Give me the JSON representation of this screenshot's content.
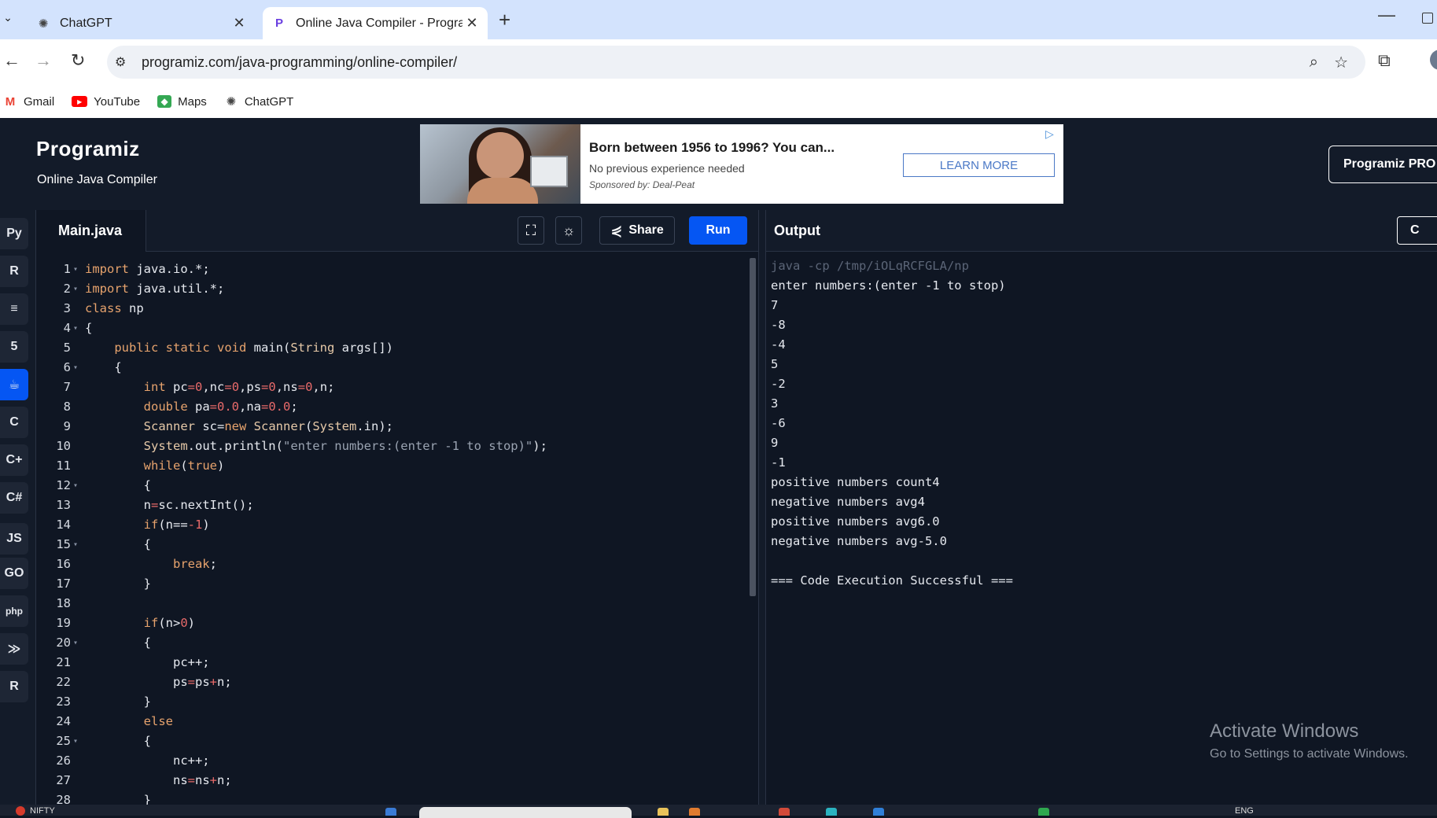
{
  "browser": {
    "tabs": [
      {
        "title": "ChatGPT",
        "icon": "chatgpt-icon",
        "active": false
      },
      {
        "title": "Online Java Compiler - Program",
        "icon": "programiz-icon",
        "active": true
      }
    ],
    "url": "programiz.com/java-programming/online-compiler/",
    "bookmarks": [
      {
        "label": "Gmail",
        "icon": "gmail-icon",
        "color": "#ea4335"
      },
      {
        "label": "YouTube",
        "icon": "youtube-icon",
        "color": "#ff0000"
      },
      {
        "label": "Maps",
        "icon": "maps-icon",
        "color": "#34a853"
      },
      {
        "label": "ChatGPT",
        "icon": "chatgpt-icon",
        "color": "#444444"
      }
    ]
  },
  "header": {
    "logo": "Programiz",
    "subtitle": "Online Java Compiler",
    "pro_button": "Programiz PRO",
    "ad": {
      "title": "Born between 1956 to 1996? You can...",
      "description": "No previous experience needed",
      "sponsor": "Sponsored by: Deal-Peat",
      "button": "LEARN MORE"
    }
  },
  "sidebar": {
    "languages": [
      {
        "name": "python",
        "label": "Py",
        "active": false
      },
      {
        "name": "r",
        "label": "R",
        "active": false
      },
      {
        "name": "sql",
        "label": "≡",
        "active": false
      },
      {
        "name": "html",
        "label": "5",
        "active": false
      },
      {
        "name": "java",
        "label": "☕",
        "active": true
      },
      {
        "name": "c",
        "label": "C",
        "active": false
      },
      {
        "name": "cpp",
        "label": "C+",
        "active": false
      },
      {
        "name": "csharp",
        "label": "C#",
        "active": false
      },
      {
        "name": "javascript",
        "label": "JS",
        "active": false
      },
      {
        "name": "go",
        "label": "GO",
        "active": false
      },
      {
        "name": "php",
        "label": "php",
        "active": false
      },
      {
        "name": "swift",
        "label": "≫",
        "active": false
      },
      {
        "name": "rust",
        "label": "R",
        "active": false
      }
    ]
  },
  "editor": {
    "file_name": "Main.java",
    "share_label": "Share",
    "run_label": "Run",
    "accent": "#0556f3"
  },
  "code_lines": [
    {
      "n": "1",
      "fold": true,
      "text": "import java.io.*;"
    },
    {
      "n": "2",
      "fold": true,
      "text": "import java.util.*;"
    },
    {
      "n": "3",
      "fold": false,
      "text": "class np"
    },
    {
      "n": "4",
      "fold": true,
      "text": "{"
    },
    {
      "n": "5",
      "fold": false,
      "text": "    public static void main(String args[])"
    },
    {
      "n": "6",
      "fold": true,
      "text": "    {"
    },
    {
      "n": "7",
      "fold": false,
      "text": "        int pc=0,nc=0,ps=0,ns=0,n;"
    },
    {
      "n": "8",
      "fold": false,
      "text": "        double pa=0.0,na=0.0;"
    },
    {
      "n": "9",
      "fold": false,
      "text": "        Scanner sc=new Scanner(System.in);"
    },
    {
      "n": "10",
      "fold": false,
      "text": "        System.out.println(\"enter numbers:(enter -1 to stop)\");"
    },
    {
      "n": "11",
      "fold": false,
      "text": "        while(true)"
    },
    {
      "n": "12",
      "fold": true,
      "text": "        {"
    },
    {
      "n": "13",
      "fold": false,
      "text": "        n=sc.nextInt();"
    },
    {
      "n": "14",
      "fold": false,
      "text": "        if(n==-1)"
    },
    {
      "n": "15",
      "fold": true,
      "text": "        {"
    },
    {
      "n": "16",
      "fold": false,
      "text": "            break;"
    },
    {
      "n": "17",
      "fold": false,
      "text": "        }"
    },
    {
      "n": "18",
      "fold": false,
      "text": ""
    },
    {
      "n": "19",
      "fold": false,
      "text": "        if(n>0)"
    },
    {
      "n": "20",
      "fold": true,
      "text": "        {"
    },
    {
      "n": "21",
      "fold": false,
      "text": "            pc++;"
    },
    {
      "n": "22",
      "fold": false,
      "text": "            ps=ps+n;"
    },
    {
      "n": "23",
      "fold": false,
      "text": "        }"
    },
    {
      "n": "24",
      "fold": false,
      "text": "        else"
    },
    {
      "n": "25",
      "fold": true,
      "text": "        {"
    },
    {
      "n": "26",
      "fold": false,
      "text": "            nc++;"
    },
    {
      "n": "27",
      "fold": false,
      "text": "            ns=ns+n;"
    },
    {
      "n": "28",
      "fold": false,
      "text": "        }"
    }
  ],
  "output": {
    "title": "Output",
    "clear_label": "C",
    "lines": [
      {
        "text": "java -cp /tmp/iOLqRCFGLA/np",
        "cmd": true
      },
      {
        "text": "enter numbers:(enter -1 to stop)",
        "cmd": false
      },
      {
        "text": "7",
        "cmd": false
      },
      {
        "text": "-8",
        "cmd": false
      },
      {
        "text": "-4",
        "cmd": false
      },
      {
        "text": "5",
        "cmd": false
      },
      {
        "text": "-2",
        "cmd": false
      },
      {
        "text": "3",
        "cmd": false
      },
      {
        "text": "-6",
        "cmd": false
      },
      {
        "text": "9",
        "cmd": false
      },
      {
        "text": "-1",
        "cmd": false
      },
      {
        "text": "positive numbers count4",
        "cmd": false
      },
      {
        "text": "negative numbers avg4",
        "cmd": false
      },
      {
        "text": "positive numbers avg6.0",
        "cmd": false
      },
      {
        "text": "negative numbers avg-5.0",
        "cmd": false
      },
      {
        "text": "",
        "cmd": false
      },
      {
        "text": "=== Code Execution Successful ===",
        "cmd": false
      }
    ]
  },
  "watermark": {
    "line1": "Activate Windows",
    "line2": "Go to Settings to activate Windows."
  },
  "taskbar": {
    "news": "NIFTY",
    "lang": "ENG"
  }
}
